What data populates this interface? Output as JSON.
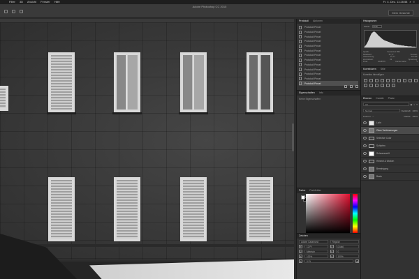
{
  "menubar": {
    "items": [
      "Filter",
      "3D",
      "Ansicht",
      "Fenster",
      "Hilfe"
    ],
    "clock": "Fr. 4. Dez. 11:28:58"
  },
  "app": {
    "title": "Adobe Photoshop CC 2015",
    "workspace": "Mein Gesichte"
  },
  "history": {
    "tabs": [
      "Protokoll",
      "Aktionen"
    ],
    "items": [
      "Protokoll Pinsel",
      "Protokoll Pinsel",
      "Protokoll Pinsel",
      "Protokoll Pinsel",
      "Protokoll Pinsel",
      "Protokoll Pinsel",
      "Protokoll Pinsel",
      "Protokoll Pinsel",
      "Protokoll Pinsel",
      "Protokoll Pinsel",
      "Protokoll Pinsel",
      "Protokoll Pinsel",
      "Protokoll Pinsel"
    ],
    "selected_index": 12
  },
  "properties": {
    "tabs": [
      "Eigenschaften",
      "Info"
    ],
    "text": "Keine Eigenschaften"
  },
  "color": {
    "tabs": [
      "Farbe",
      "Farbfelder"
    ],
    "foreground": "#ffffff",
    "background": "#111111",
    "hue": "#e01030"
  },
  "character": {
    "tabs": [
      "Zeichen"
    ],
    "font": "Adobe Garamond",
    "style": "Regular",
    "size": "12 Pt",
    "leading": "(Auto)",
    "kerning": "Metrisch",
    "tracking": "0",
    "scale_v": "100%",
    "scale_h": "100%",
    "baseline": "0 Pt"
  },
  "histogram": {
    "tabs": [
      "Histogramm"
    ],
    "channel_label": "Kanal:",
    "channel": "RGB",
    "stats": [
      {
        "label": "Mittelwert:",
        "value": "41,77",
        "label2": "Tonwert:",
        "value2": ""
      },
      {
        "label": "Abweichung:",
        "value": "31,77",
        "label2": "Anzahl:",
        "value2": ""
      },
      {
        "label": "Zentralwert:",
        "value": "33",
        "label2": "Spreizung:",
        "value2": ""
      },
      {
        "label": "Pixel:",
        "value": "1048576",
        "label2": "Cache-Stufe:",
        "value2": "4"
      }
    ],
    "source_label": "Quelle:",
    "source": "Gesamtes Bild",
    "bins": [
      2,
      5,
      9,
      14,
      20,
      27,
      33,
      38,
      40,
      42,
      41,
      39,
      36,
      33,
      30,
      28,
      25,
      23,
      21,
      19,
      18,
      17,
      16,
      15,
      14,
      13,
      12,
      11,
      10,
      9,
      8,
      8,
      7,
      7,
      6,
      6,
      5,
      5,
      5,
      4,
      4,
      4,
      3,
      3,
      3,
      3,
      2,
      2,
      2,
      2
    ]
  },
  "adjustments": {
    "tabs": [
      "Korrekturen",
      "Stile"
    ],
    "label": "Korrektur hinzufügen"
  },
  "layers": {
    "tabs": [
      "Ebenen",
      "Kanäle",
      "Pfade"
    ],
    "filter": "Art",
    "blend": "Normal",
    "opacity_label": "Deckkraft:",
    "opacity": "100%",
    "lock_label": "Fixieren:",
    "fill_label": "Fläche:",
    "fill": "100%",
    "items": [
      {
        "name": "Licht",
        "type": "adj"
      },
      {
        "name": "Ohne Verfeinerungen",
        "type": "layer"
      },
      {
        "name": "Selective Color",
        "type": "folder"
      },
      {
        "name": "Schärfen",
        "type": "folder"
      },
      {
        "name": "Schwarzweiß",
        "type": "mask"
      },
      {
        "name": "Himmel & Wolken",
        "type": "folder"
      },
      {
        "name": "Bereinigung",
        "type": "layer"
      },
      {
        "name": "Basis",
        "type": "layer"
      }
    ],
    "selected_index": 1
  }
}
